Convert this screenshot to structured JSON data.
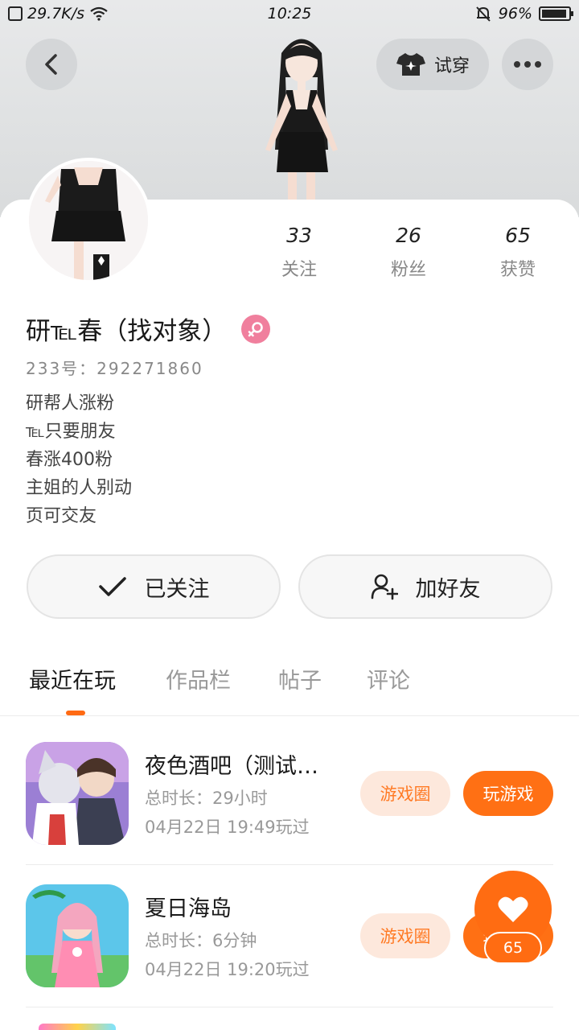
{
  "status_bar": {
    "net_speed": "29.7K/s",
    "time": "10:25",
    "battery": "96%"
  },
  "header": {
    "tryon_label": "试穿"
  },
  "profile": {
    "username": "研℡春（找对象）",
    "uid": "233号：292271860",
    "bio": [
      "研帮人涨粉",
      "℡只要朋友",
      "春涨400粉",
      "主姐的人别动",
      "页可交友"
    ],
    "stats": [
      {
        "value": "33",
        "label": "关注"
      },
      {
        "value": "26",
        "label": "粉丝"
      },
      {
        "value": "65",
        "label": "获赞"
      }
    ],
    "gender_color": "#f07f9d"
  },
  "actions": {
    "followed_label": "已关注",
    "add_friend_label": "加好友"
  },
  "tabs": [
    "最近在玩",
    "作品栏",
    "帖子",
    "评论"
  ],
  "games": [
    {
      "title": "夜色酒吧（测试…",
      "duration": "总时长：29小时",
      "last_played": "04月22日 19:49玩过",
      "circle_label": "游戏圈",
      "play_label": "玩游戏"
    },
    {
      "title": "夏日海岛",
      "duration": "总时长：6分钟",
      "last_played": "04月22日 19:20玩过",
      "circle_label": "游戏圈",
      "play_label": "玩游戏"
    }
  ],
  "like_fab": {
    "count": "65"
  },
  "colors": {
    "accent": "#ff7014",
    "accent_light": "#fde8dc"
  }
}
